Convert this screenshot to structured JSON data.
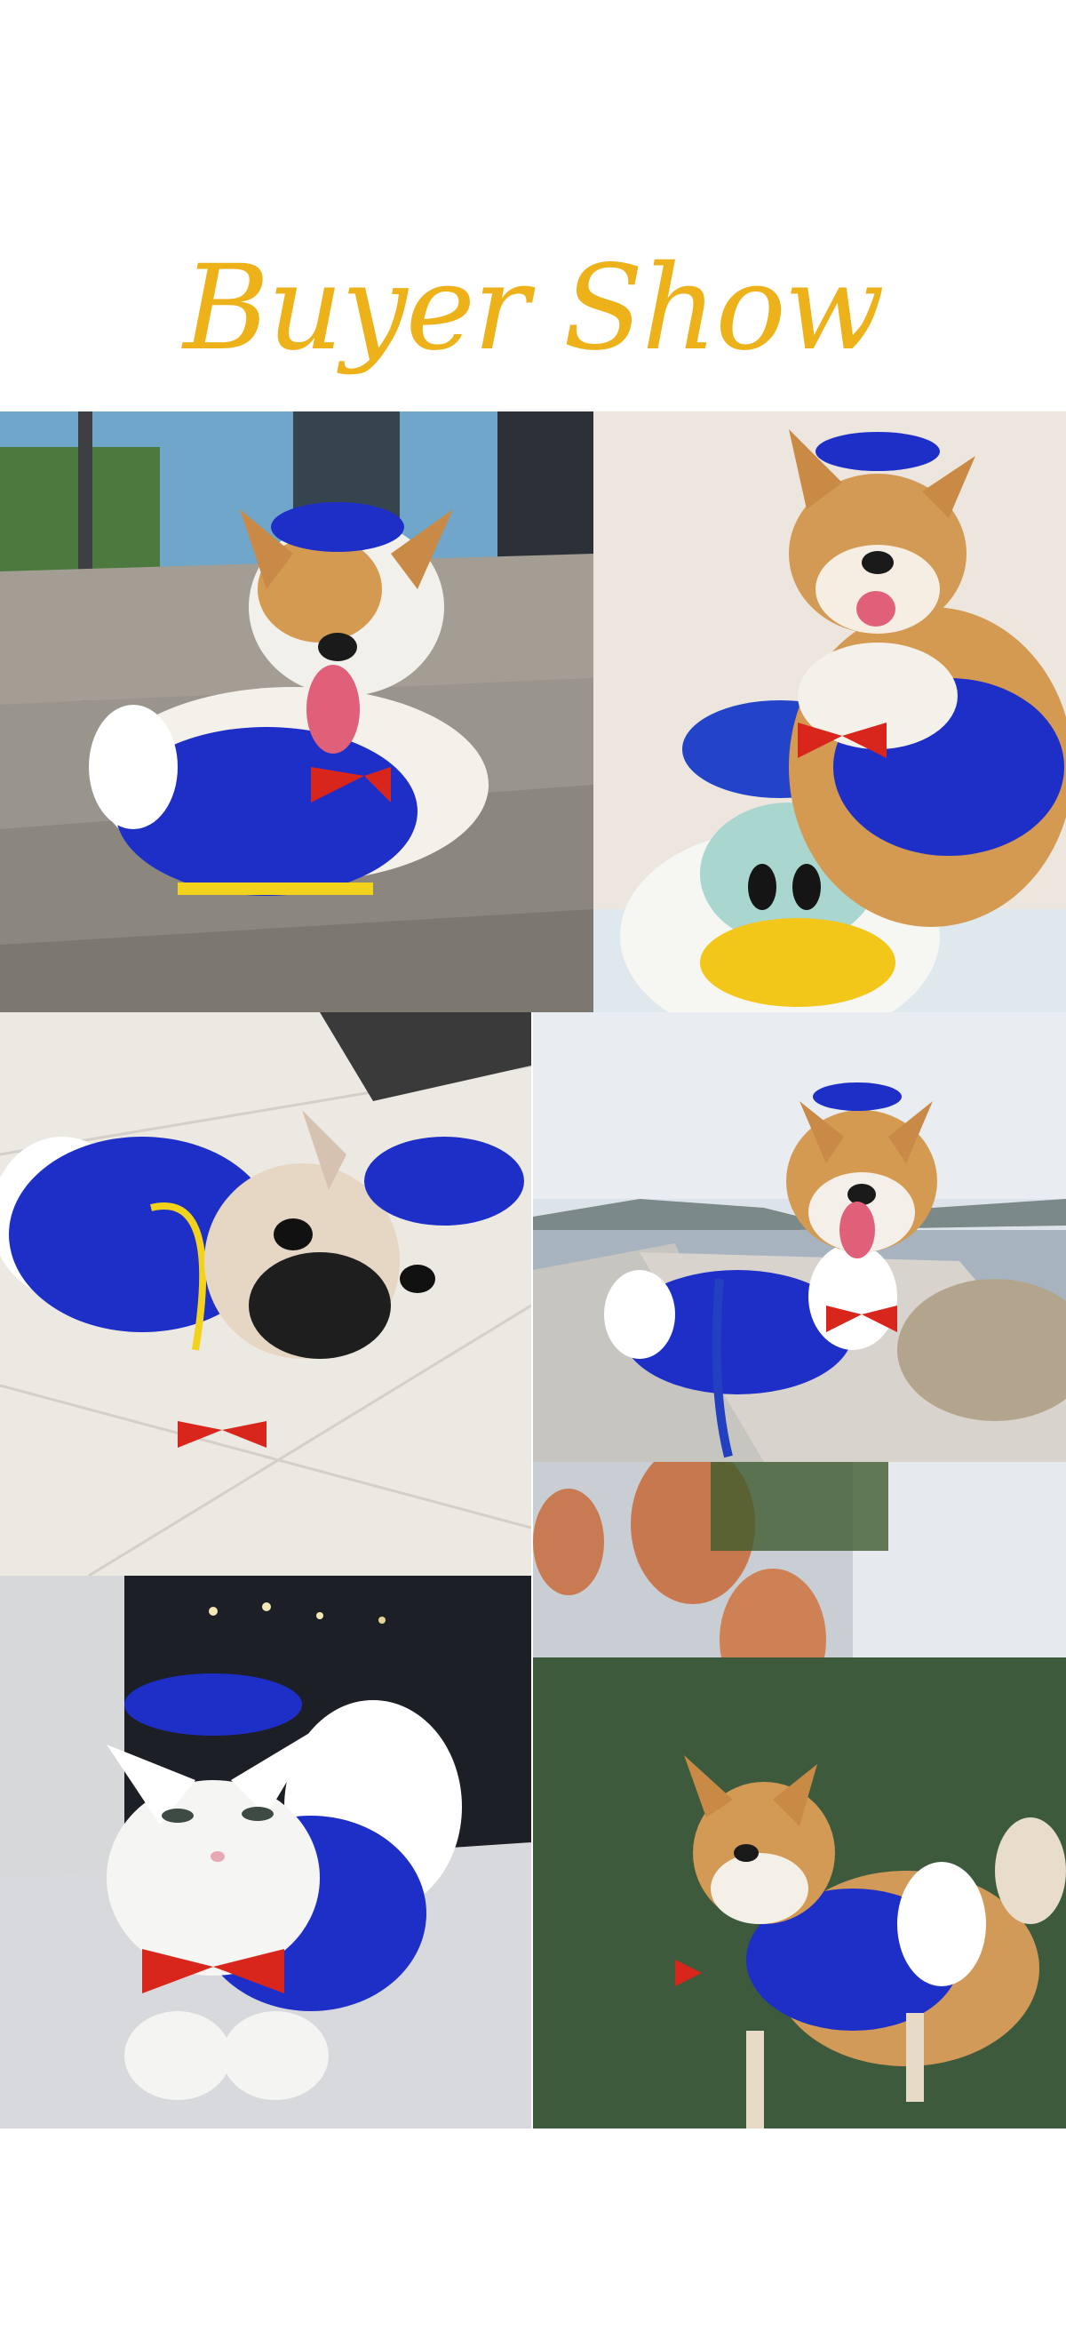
{
  "title": "Buyer Show",
  "colors": {
    "title": "#EDB21A",
    "costume_blue": "#1E2FC8",
    "costume_stripe": "#F2D21A",
    "bow_red": "#D9261C",
    "background": "#FFFFFF"
  },
  "photos": [
    {
      "name": "corgi-on-stairs-photo",
      "subject": "corgi"
    },
    {
      "name": "shiba-with-donald-plush-photo",
      "subject": "shiba"
    },
    {
      "name": "french-bulldog-on-tiles-photo",
      "subject": "french-bulldog"
    },
    {
      "name": "corgi-by-harbor-photo",
      "subject": "corgi"
    },
    {
      "name": "white-cat-in-costume-photo",
      "subject": "cat"
    },
    {
      "name": "shiba-on-grass-photo",
      "subject": "shiba"
    }
  ]
}
